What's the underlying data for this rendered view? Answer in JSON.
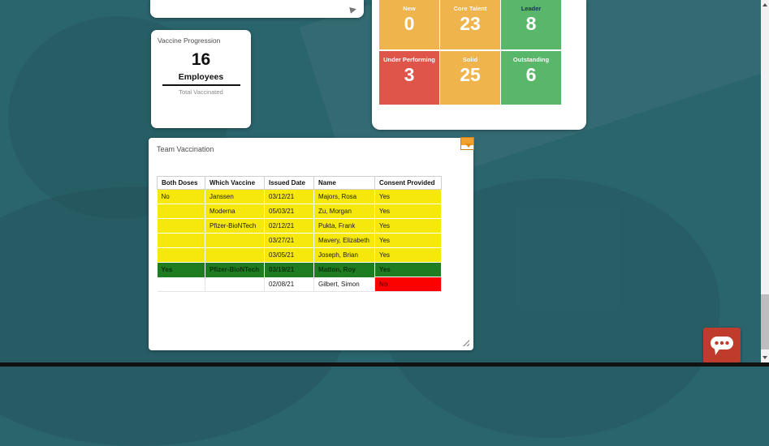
{
  "vaccine_progression": {
    "title": "Vaccine Progression",
    "count": "16",
    "unit": "Employees",
    "caption": "Total Vaccinated"
  },
  "talent_grid": {
    "colors": {
      "yellow": "#f0b44d",
      "green": "#58b768",
      "red": "#e0554a"
    },
    "label_colors": {
      "light": "#ffffff",
      "dark": "#1f3a60"
    },
    "tiles": [
      {
        "label": "New",
        "value": "0",
        "color": "yellow",
        "label_tone": "light"
      },
      {
        "label": "Core Talent",
        "value": "23",
        "color": "yellow",
        "label_tone": "light"
      },
      {
        "label": "Leader",
        "value": "8",
        "color": "green",
        "label_tone": "dark"
      },
      {
        "label": "Under Performing",
        "value": "3",
        "color": "red",
        "label_tone": "light"
      },
      {
        "label": "Solid",
        "value": "25",
        "color": "yellow",
        "label_tone": "light"
      },
      {
        "label": "Outstanding",
        "value": "6",
        "color": "green",
        "label_tone": "light"
      }
    ]
  },
  "team_vaccination": {
    "title": "Team Vaccination",
    "columns": [
      "Both Doses",
      "Which Vaccine",
      "Issued Date",
      "Name",
      "Consent Provided"
    ],
    "row_colors": {
      "yellow": "#f7e80b",
      "green": "#1e7d20",
      "white": "#ffffff",
      "red": "#fb0200"
    },
    "rows": [
      {
        "cells": [
          "No",
          "Janssen",
          "03/12/21",
          "Majors, Rosa",
          "Yes"
        ],
        "highlight": "yellow"
      },
      {
        "cells": [
          "",
          "Moderna",
          "05/03/21",
          "Zu, Morgan",
          "Yes"
        ],
        "highlight": "yellow"
      },
      {
        "cells": [
          "",
          "Pfizer-BioNTech",
          "02/12/21",
          "Pukta, Frank",
          "Yes"
        ],
        "highlight": "yellow"
      },
      {
        "cells": [
          "",
          "",
          "03/27/21",
          "Mavery, Elizabeth",
          "Yes"
        ],
        "highlight": "yellow"
      },
      {
        "cells": [
          "",
          "",
          "03/05/21",
          "Joseph, Brian",
          "Yes"
        ],
        "highlight": "yellow"
      },
      {
        "cells": [
          "Yes",
          "Pfizer-BioNTech",
          "03/19/21",
          "Matton, Roy",
          "Yes"
        ],
        "highlight": "green"
      },
      {
        "cells": [
          "",
          "",
          "02/08/21",
          "Gilbert, Simon",
          "No"
        ],
        "highlight": "white",
        "consent_highlight": "red"
      }
    ]
  },
  "chat_button": {
    "color": "#bf3b2c"
  }
}
